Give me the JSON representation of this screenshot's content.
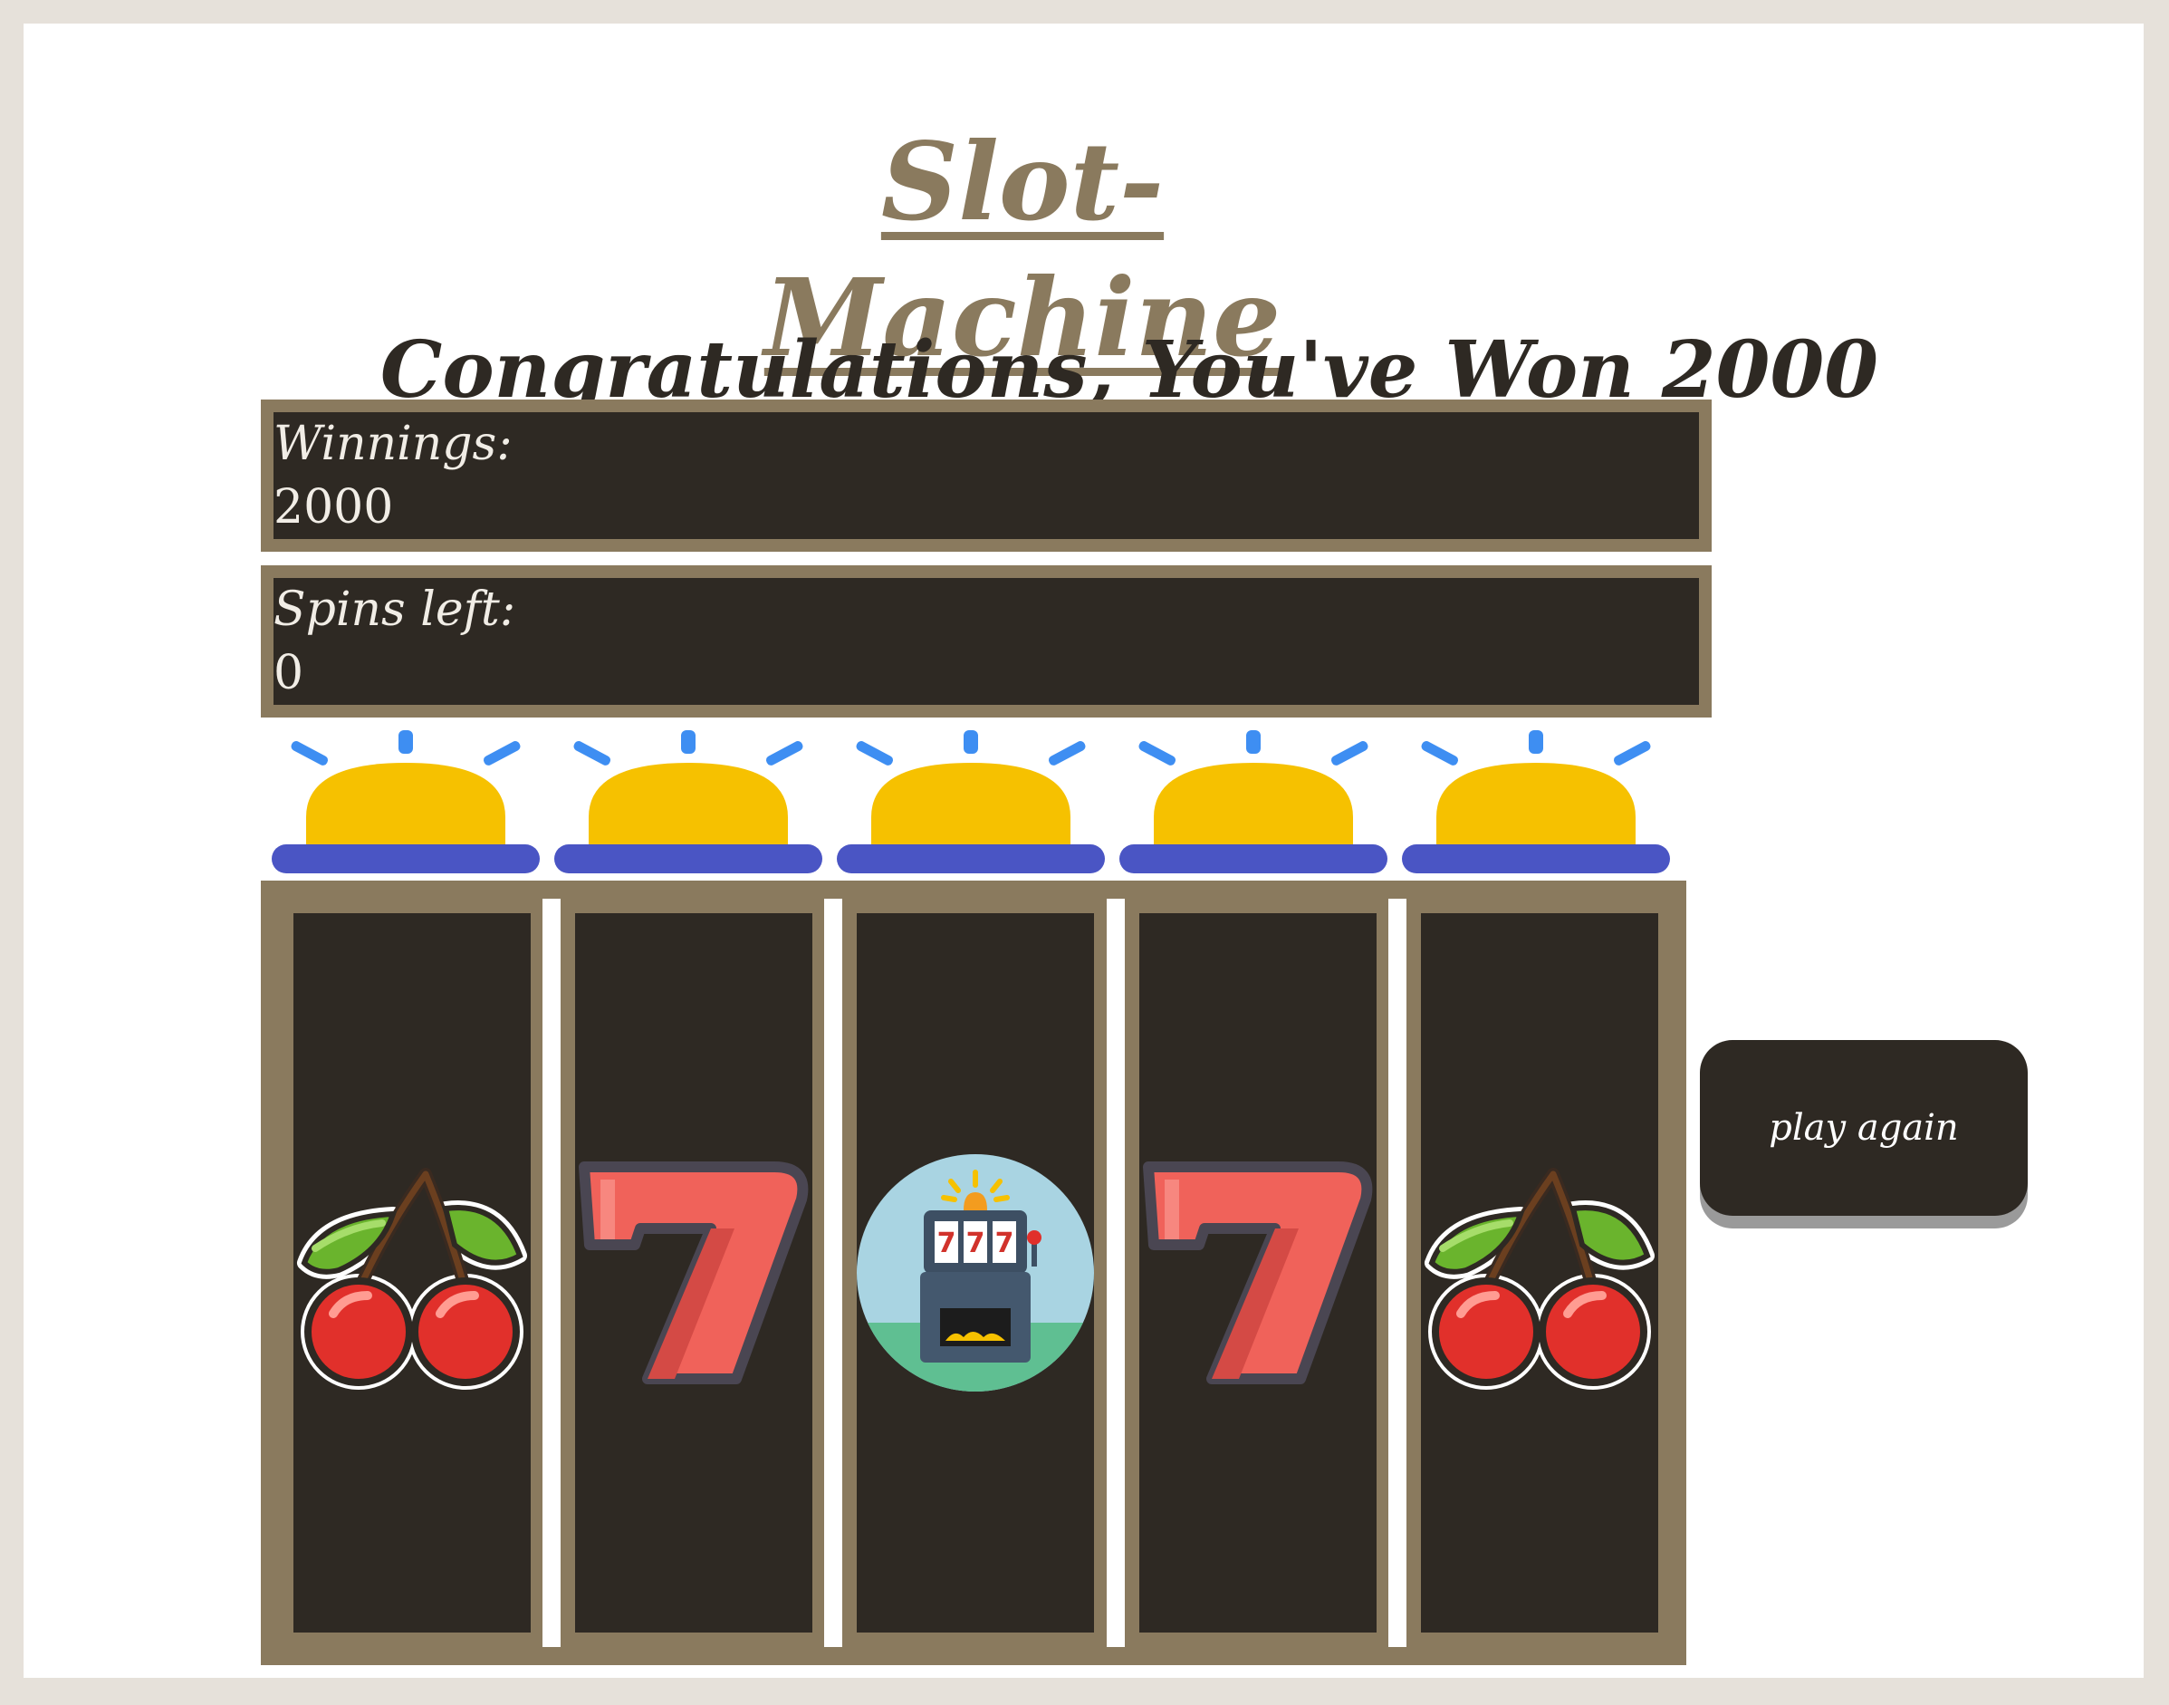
{
  "header": {
    "title": "Slot-Machine",
    "message": "Congratulations, You've Won 2000"
  },
  "stats": {
    "winnings_label": "Winnings:",
    "winnings_value": "2000",
    "spins_label": "Spins left:",
    "spins_value": "0"
  },
  "reels": [
    {
      "symbol": "cherry-icon"
    },
    {
      "symbol": "seven-icon"
    },
    {
      "symbol": "slot-machine-icon"
    },
    {
      "symbol": "seven-icon"
    },
    {
      "symbol": "cherry-icon"
    }
  ],
  "slot_machine_icon_text": "777",
  "controls": {
    "play_again_label": "play again"
  },
  "colors": {
    "accent": "#8a7a5e",
    "dark": "#2e2923",
    "light_dome": "#f6c100",
    "light_base": "#4a55c4",
    "light_rays": "#3e8ef2",
    "seven": "#f0625a",
    "cherry": "#e1302b",
    "leaf": "#6ab42d"
  }
}
